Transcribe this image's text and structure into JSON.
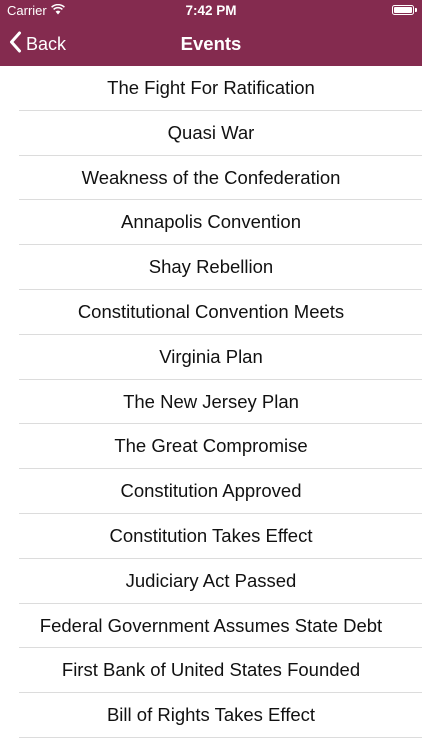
{
  "status_bar": {
    "carrier": "Carrier",
    "time": "7:42 PM"
  },
  "nav": {
    "back_label": "Back",
    "title": "Events"
  },
  "colors": {
    "header_bg": "#842b4f",
    "text": "#111111",
    "separator": "#dcdcdc"
  },
  "events": [
    "The Fight For Ratification",
    "Quasi War",
    "Weakness of the Confederation",
    "Annapolis Convention",
    "Shay Rebellion",
    "Constitutional Convention Meets",
    "Virginia Plan",
    "The New Jersey Plan",
    "The Great Compromise",
    "Constitution Approved",
    "Constitution Takes Effect",
    "Judiciary Act Passed",
    "Federal Government Assumes State Debt",
    "First Bank of United States Founded",
    "Bill of Rights Takes Effect"
  ]
}
